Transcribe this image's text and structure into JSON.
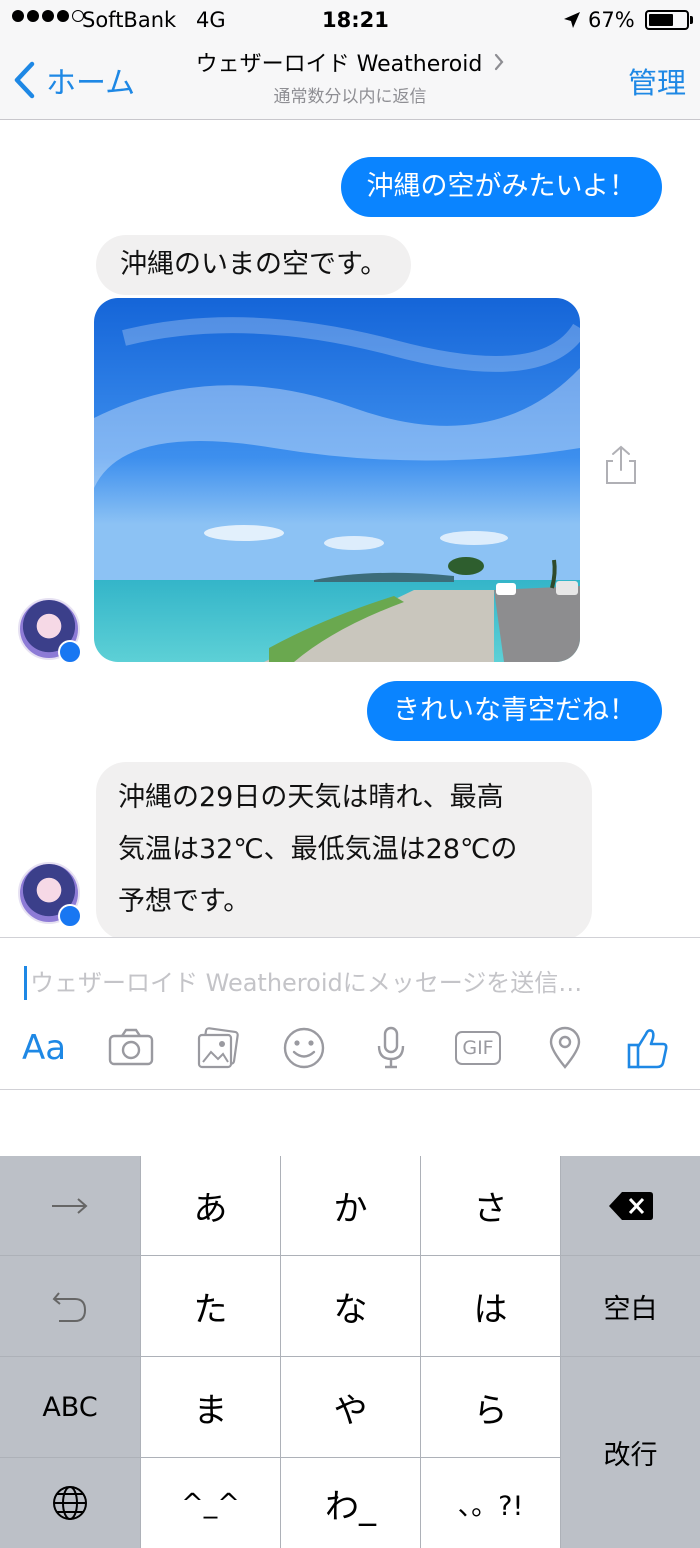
{
  "status_bar": {
    "carrier": "SoftBank",
    "network": "4G",
    "time": "18:21",
    "battery_percent": "67%",
    "battery_level": 0.67,
    "signal_bars": 4,
    "icons": [
      "location-arrow-icon",
      "battery-icon"
    ]
  },
  "nav": {
    "back_label": "ホーム",
    "title": "ウェザーロイド Weatheroid",
    "subtitle": "通常数分以内に返信",
    "manage_label": "管理",
    "icons": [
      "chevron-left-icon",
      "chevron-right-icon"
    ]
  },
  "messages": [
    {
      "direction": "out",
      "text": "沖縄の空がみたいよ！"
    },
    {
      "direction": "in",
      "text": "沖縄のいまの空です。"
    },
    {
      "direction": "in",
      "type": "image",
      "subject": "okinawa-sky-photo"
    },
    {
      "direction": "out",
      "text": "きれいな青空だね！"
    },
    {
      "direction": "in",
      "lines": [
        "沖縄の29日の天気は晴れ、最高",
        "気温は32℃、最低気温は28℃の",
        "予想です。"
      ]
    }
  ],
  "composer": {
    "placeholder": "ウェザーロイド Weatheroidにメッセージを送信…",
    "aa_label": "Aa",
    "gif_label": "GIF",
    "tools": [
      "text-format-icon",
      "camera-icon",
      "photo-gallery-icon",
      "emoji-icon",
      "microphone-icon",
      "gif-icon",
      "location-pin-icon",
      "thumbs-up-icon"
    ]
  },
  "keyboard": {
    "rows": [
      [
        "→",
        "あ",
        "か",
        "さ",
        "⌫"
      ],
      [
        "↺",
        "た",
        "な",
        "は",
        "空白"
      ],
      [
        "ABC",
        "ま",
        "や",
        "ら",
        "改行"
      ],
      [
        "🌐",
        "^_^",
        "わ_",
        "、。?!"
      ]
    ],
    "space_label": "空白",
    "return_label": "改行",
    "abc_label": "ABC",
    "kaomoji_label": "^_^",
    "wa_label": "わ_",
    "punct_label": "、。?!"
  },
  "colors": {
    "accent": "#1e88e5",
    "outgoing_bubble": "#0a84ff",
    "incoming_bubble": "#f1f0f0",
    "keyboard_dark": "#bcc0c7",
    "keyboard_light": "#ffffff"
  }
}
